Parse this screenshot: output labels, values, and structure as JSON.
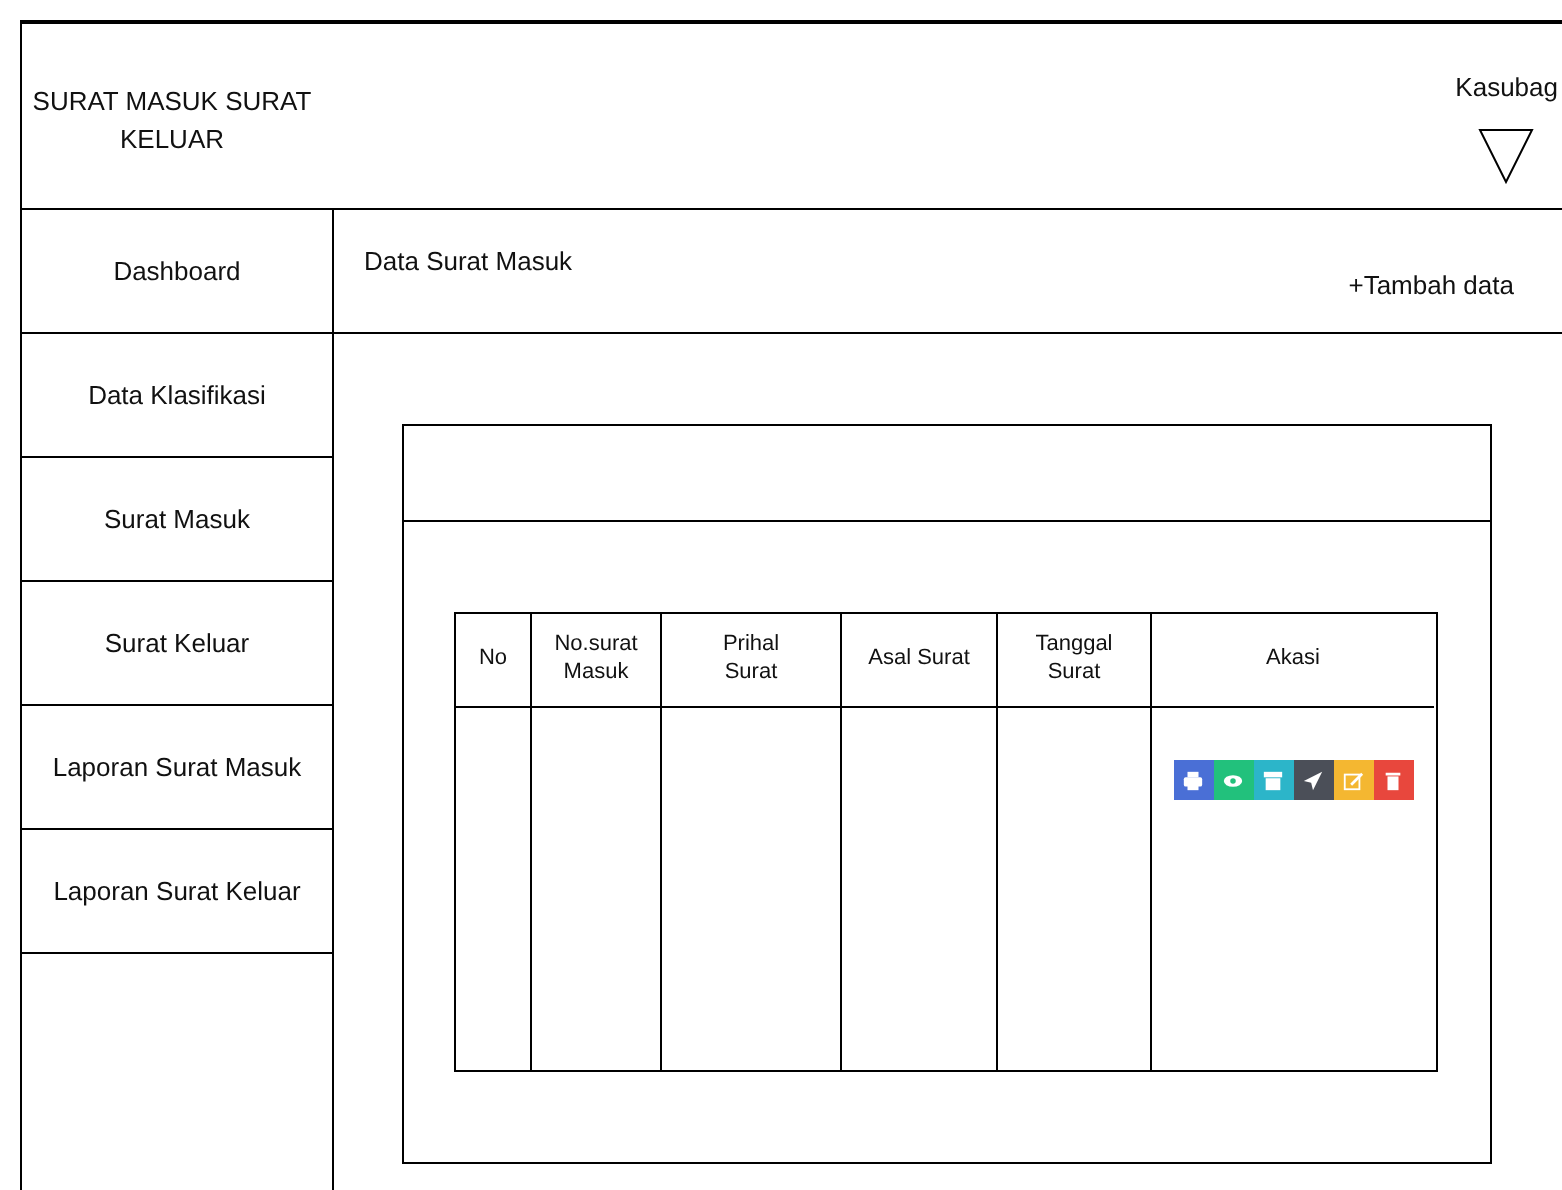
{
  "header": {
    "app_title": "SURAT  MASUK SURAT KELUAR",
    "user": "Kasubag"
  },
  "sidebar": {
    "items": [
      {
        "label": "Dashboard"
      },
      {
        "label": "Data Klasifikasi"
      },
      {
        "label": "Surat Masuk"
      },
      {
        "label": "Surat Keluar"
      },
      {
        "label": "Laporan Surat Masuk"
      },
      {
        "label": "Laporan Surat Keluar"
      }
    ]
  },
  "content": {
    "title": "Data Surat Masuk",
    "add_button": "+Tambah data"
  },
  "table": {
    "columns": [
      {
        "label": "No"
      },
      {
        "label": "No.surat Masuk"
      },
      {
        "label": "Prihal Surat"
      },
      {
        "label": "Asal Surat"
      },
      {
        "label": "Tanggal Surat"
      },
      {
        "label": "Akasi"
      }
    ],
    "actions": [
      {
        "kind": "print",
        "color": "#4a6fd6"
      },
      {
        "kind": "view",
        "color": "#22c17c"
      },
      {
        "kind": "archive",
        "color": "#2cb5c9"
      },
      {
        "kind": "send",
        "color": "#4b4f58"
      },
      {
        "kind": "edit",
        "color": "#f4b731"
      },
      {
        "kind": "delete",
        "color": "#e8473d"
      }
    ]
  }
}
